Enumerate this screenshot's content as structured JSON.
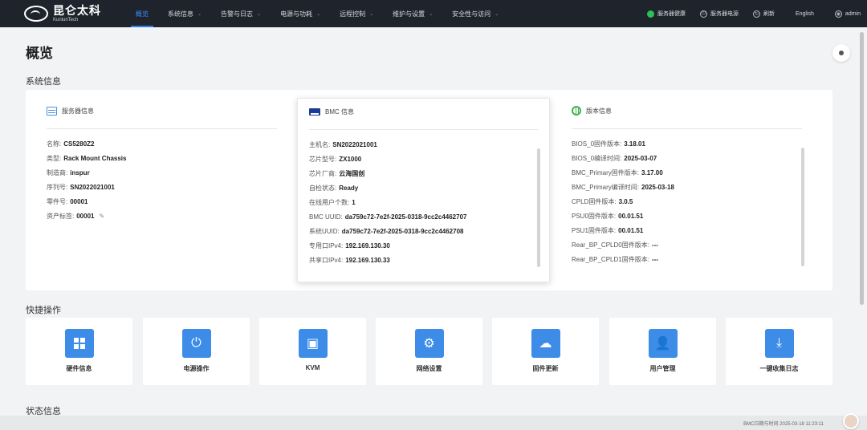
{
  "brand": {
    "name_cn": "昆仑太科",
    "name_en": "KunlunTech"
  },
  "nav": [
    {
      "label": "概览",
      "active": true,
      "dropdown": false
    },
    {
      "label": "系统信息",
      "dropdown": true
    },
    {
      "label": "告警与日志",
      "dropdown": true
    },
    {
      "label": "电源与功耗",
      "dropdown": true
    },
    {
      "label": "远程控制",
      "dropdown": true
    },
    {
      "label": "维护与设置",
      "dropdown": true
    },
    {
      "label": "安全性与访问",
      "dropdown": true
    }
  ],
  "header_right": {
    "health": "服务器健康",
    "power": "服务器电源",
    "refresh": "刷新",
    "language": "English",
    "user": "admin"
  },
  "page": {
    "title": "概览"
  },
  "sections": {
    "system_info": "系统信息",
    "quick_ops": "快捷操作",
    "status_info": "状态信息"
  },
  "server_info": {
    "title": "服务器信息",
    "rows": [
      {
        "label": "名称:",
        "value": "CS5280Z2"
      },
      {
        "label": "类型:",
        "value": "Rack Mount Chassis"
      },
      {
        "label": "制造商:",
        "value": "inspur"
      },
      {
        "label": "序列号:",
        "value": "SN2022021001"
      },
      {
        "label": "零件号:",
        "value": "00001"
      },
      {
        "label": "资产标签:",
        "value": "00001"
      }
    ]
  },
  "bmc_info": {
    "title": "BMC 信息",
    "rows": [
      {
        "label": "主机名:",
        "value": "SN2022021001"
      },
      {
        "label": "芯片型号:",
        "value": "ZX1000"
      },
      {
        "label": "芯片厂商:",
        "value": "云海国创"
      },
      {
        "label": "自检状态:",
        "value": "Ready"
      },
      {
        "label": "在线用户个数:",
        "value": "1"
      },
      {
        "label": "BMC UUID:",
        "value": "da759c72-7e2f-2025-0318-9cc2c4462707"
      },
      {
        "label": "系统UUID:",
        "value": "da759c72-7e2f-2025-0318-9cc2c4462708"
      },
      {
        "label": "专用口IPv4:",
        "value": "192.169.130.30"
      },
      {
        "label": "共享口IPv4:",
        "value": "192.169.130.33"
      }
    ]
  },
  "version_info": {
    "title": "版本信息",
    "rows": [
      {
        "label": "BIOS_0固件版本:",
        "value": "3.18.01"
      },
      {
        "label": "BIOS_0编译时间:",
        "value": "2025-03-07"
      },
      {
        "label": "BMC_Primary固件版本:",
        "value": "3.17.00"
      },
      {
        "label": "BMC_Primary编译时间:",
        "value": "2025-03-18"
      },
      {
        "label": "CPLD固件版本:",
        "value": "3.0.5"
      },
      {
        "label": "PSU0固件版本:",
        "value": "00.01.51"
      },
      {
        "label": "PSU1固件版本:",
        "value": "00.01.51"
      },
      {
        "label": "Rear_BP_CPLD0固件版本:",
        "value": "---"
      },
      {
        "label": "Rear_BP_CPLD1固件版本:",
        "value": "---"
      }
    ]
  },
  "quick_actions": [
    {
      "label": "硬件信息",
      "icon": "grid-icon"
    },
    {
      "label": "电源操作",
      "icon": "power-icon"
    },
    {
      "label": "KVM",
      "icon": "kvm-icon"
    },
    {
      "label": "网络设置",
      "icon": "gear-icon"
    },
    {
      "label": "固件更新",
      "icon": "cloud-upload-icon"
    },
    {
      "label": "用户管理",
      "icon": "user-icon"
    },
    {
      "label": "一键收集日志",
      "icon": "download-icon"
    }
  ],
  "footer": {
    "text": "BMC日期与时间 2025-03-18 11:23:11"
  },
  "colors": {
    "nav_bg": "#1f242c",
    "accent": "#2f7cf6",
    "action_blue": "#3d8de8",
    "health_green": "#2bc253"
  }
}
